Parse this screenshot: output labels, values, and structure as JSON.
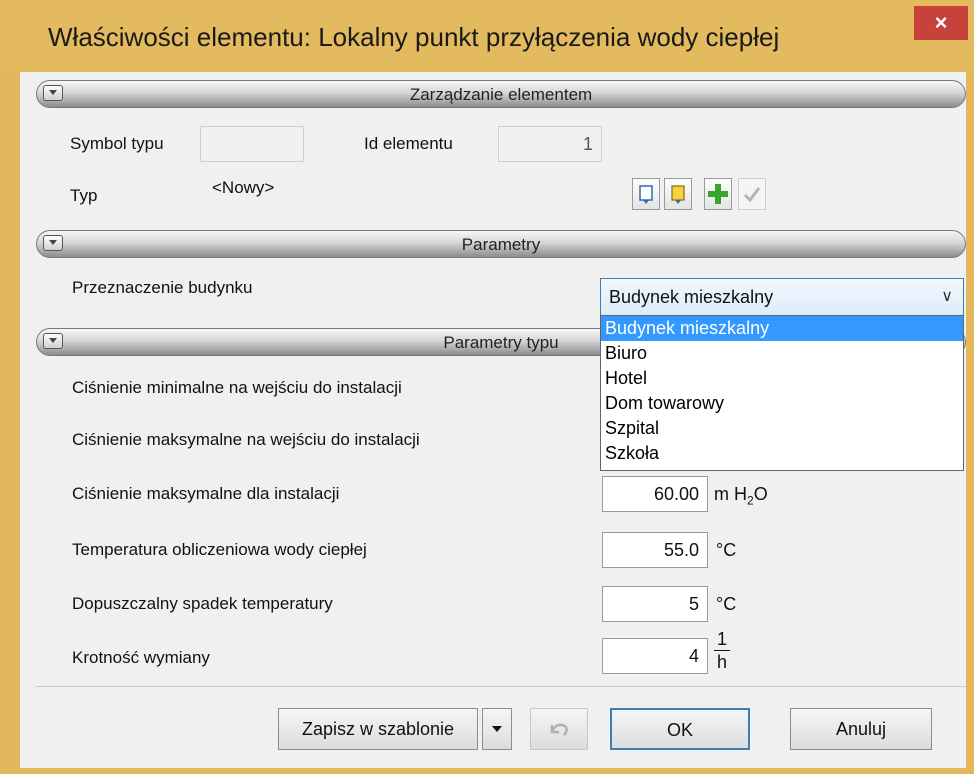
{
  "window": {
    "title": "Właściwości elementu: Lokalny punkt przyłączenia wody ciepłej",
    "close": "×"
  },
  "sections": {
    "management": "Zarządzanie elementem",
    "parameters": "Parametry",
    "type_parameters": "Parametry typu"
  },
  "management": {
    "symbol_label": "Symbol typu",
    "symbol_value": "",
    "id_label": "Id elementu",
    "id_value": "1",
    "type_label": "Typ",
    "type_value": "<Nowy>"
  },
  "parameters": {
    "purpose_label": "Przeznaczenie budynku",
    "purpose_value": "Budynek mieszkalny",
    "options": [
      "Budynek mieszkalny",
      "Biuro",
      "Hotel",
      "Dom towarowy",
      "Szpital",
      "Szkoła"
    ]
  },
  "type_params": {
    "p_min_label": "Ciśnienie minimalne na wejściu do instalacji",
    "p_max_input_label": "Ciśnienie maksymalne na wejściu do instalacji",
    "p_max_inst_label": "Ciśnienie maksymalne dla instalacji",
    "p_max_inst_value": "60.00",
    "p_max_inst_unit_main": "m H",
    "p_max_inst_unit_sub": "2",
    "p_max_inst_unit_tail": "O",
    "temp_label": "Temperatura obliczeniowa wody ciepłej",
    "temp_value": "55.0",
    "temp_unit": "°C",
    "drop_label": "Dopuszczalny spadek temperatury",
    "drop_value": "5",
    "drop_unit": "°C",
    "exchange_label": "Krotność wymiany",
    "exchange_value": "4",
    "exchange_unit_num": "1",
    "exchange_unit_den": "h"
  },
  "footer": {
    "save_template": "Zapisz w szablonie",
    "ok": "OK",
    "cancel": "Anuluj"
  },
  "colors": {
    "title_bar": "#e4ba5f",
    "close": "#c7423a",
    "selection": "#3399ff",
    "accent_border": "#3c7fb1"
  }
}
